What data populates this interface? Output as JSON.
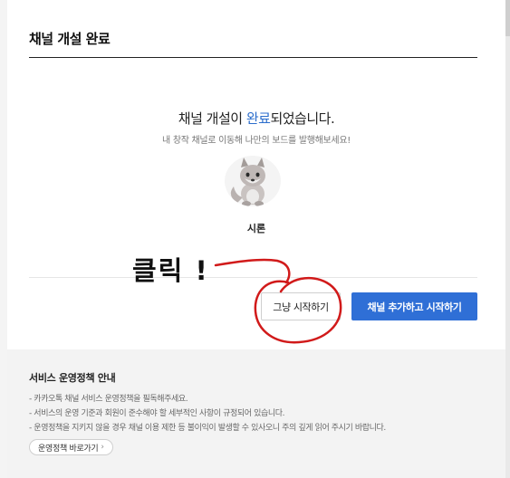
{
  "modal": {
    "title": "채널 개설 완료",
    "headline_prefix": "채널 개설이 ",
    "headline_accent": "완료",
    "headline_suffix": "되었습니다.",
    "subline": "내 창작 채널로 이동해 나만의 보드를 발행해보세요!",
    "avatar_icon": "wolf-character-icon",
    "channel_name": "시론",
    "skip_button_label": "그냥 시작하기",
    "add_button_label": "채널 추가하고 시작하기"
  },
  "footer": {
    "title": "서비스 운영정책 안내",
    "lines": [
      "- 카카오톡 채널 서비스 운영정책을 필독해주세요.",
      "- 서비스의 운영 기준과 회원이 준수해야 할 세부적인 사항이 규정되어 있습니다.",
      "- 운영정책을 지키지 않을 경우 채널 이용 제한 등 불이익이 발생할 수 있사오니 주의 깊게 읽어 주시기 바랍니다."
    ],
    "policy_link_label": "운영정책 바로가기"
  },
  "annotation": {
    "text": "클릭 !",
    "color": "#d11a1a"
  },
  "colors": {
    "accent": "#2b6dcc",
    "primary_button": "#2f6fd6"
  }
}
